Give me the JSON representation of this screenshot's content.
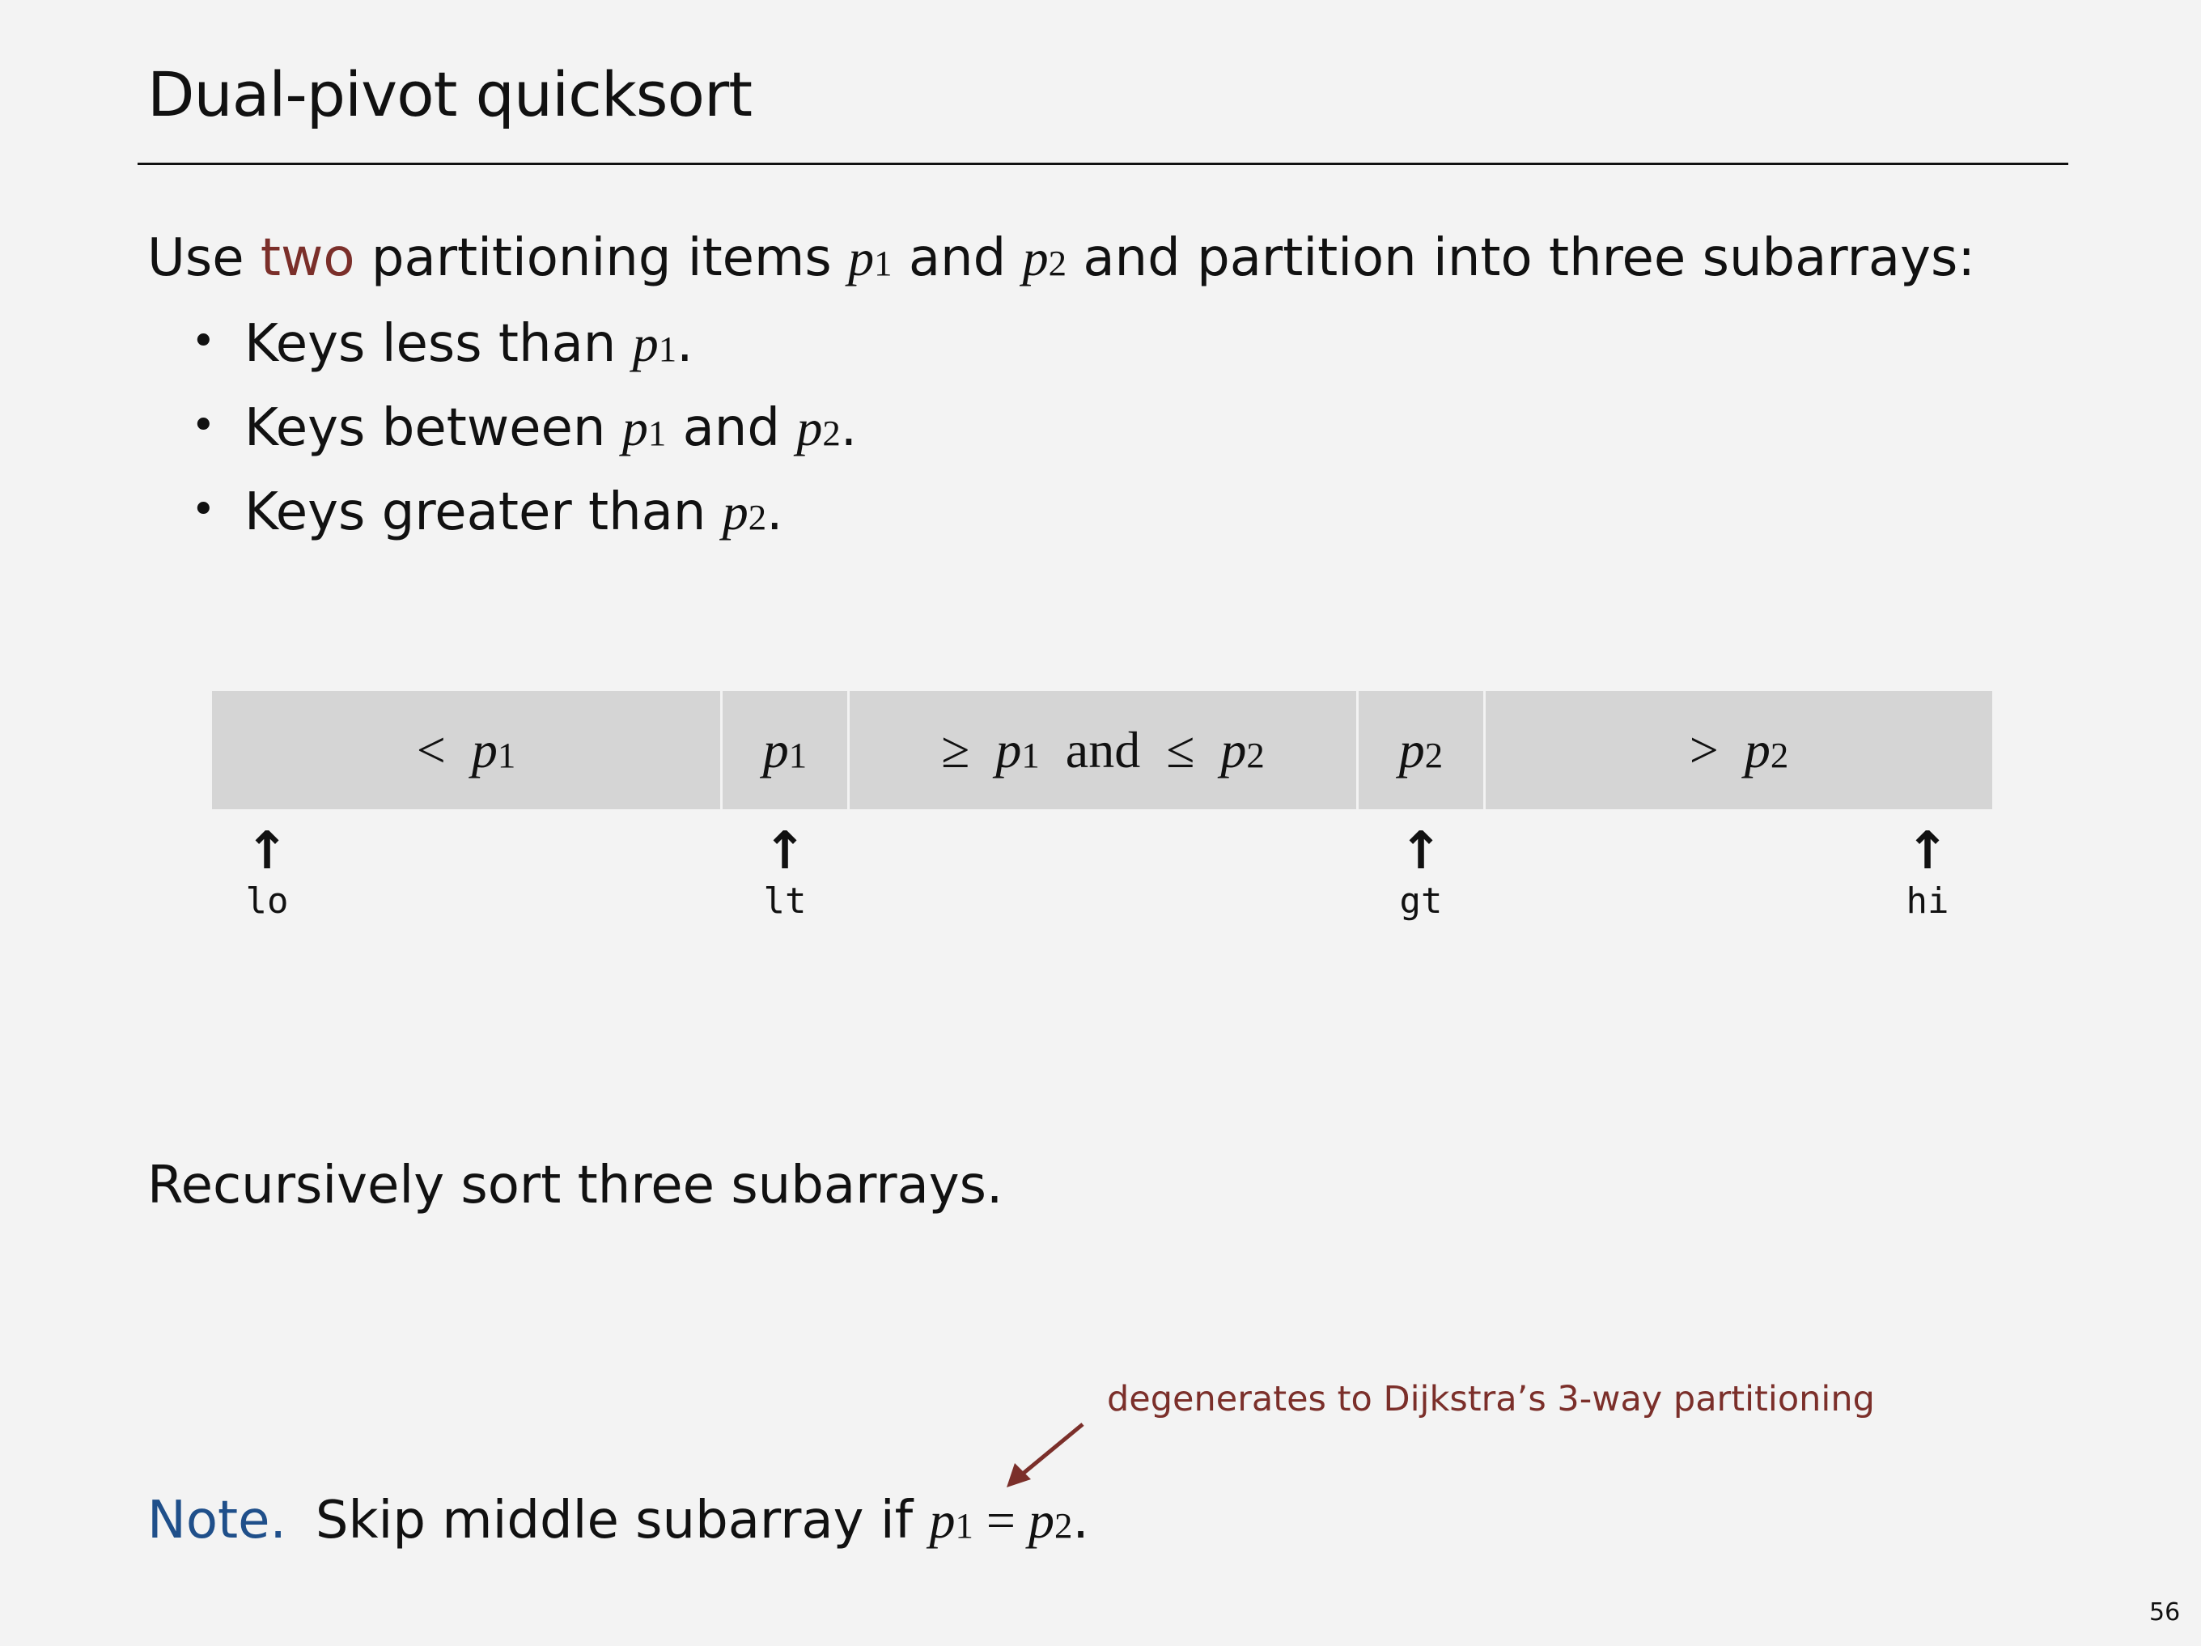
{
  "slide": {
    "title": "Dual-pivot quicksort",
    "page_number": "56"
  },
  "intro": {
    "t1": "Use ",
    "accent": "two",
    "t2": " partitioning items ",
    "p": "p",
    "one": "1",
    "two_sub": "2",
    "and": " and ",
    "t3": " and partition into three subarrays:"
  },
  "bullets": [
    {
      "text": "Keys less than ",
      "end": "."
    },
    {
      "text": "Keys between ",
      "mid": " and ",
      "end": "."
    },
    {
      "text": "Keys greater than ",
      "end": "."
    }
  ],
  "diagram": {
    "cells": {
      "less_sym": "<",
      "geq_sym": "≥",
      "and_word": "and",
      "leq_sym": "≤",
      "gt_sym": ">"
    },
    "pointers": [
      "lo",
      "lt",
      "gt",
      "hi"
    ],
    "arrow": "↑"
  },
  "recurse": "Recursively sort three subarrays.",
  "annotation": "degenerates to Dijkstra’s 3-way partitioning",
  "note": {
    "label": "Note.",
    "text": "Skip middle subarray if ",
    "eq": " = ",
    "end": "."
  },
  "colors": {
    "accent": "#7b2f2a",
    "note_label": "#1f4f8a",
    "cell_bg": "#d5d5d5",
    "background": "#f3f3f3"
  }
}
